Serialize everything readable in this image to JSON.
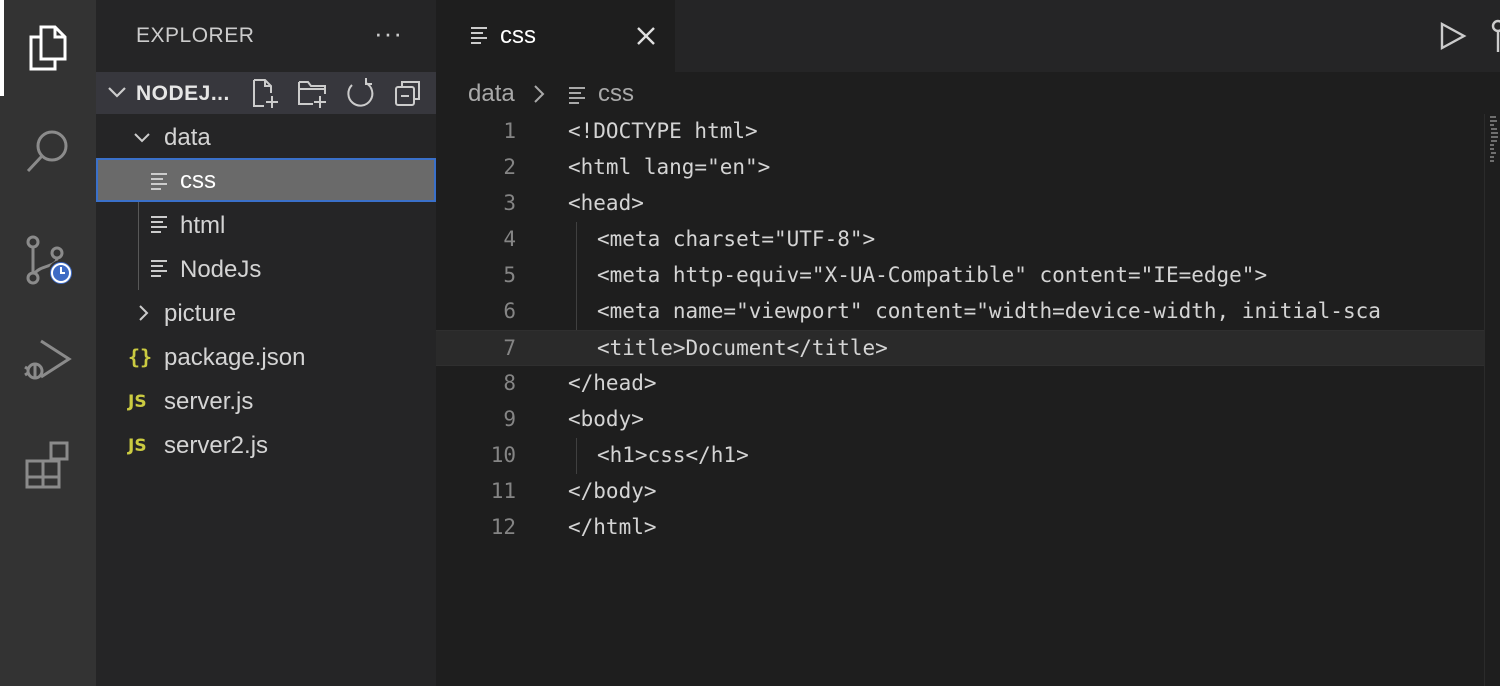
{
  "sidebar": {
    "title": "EXPLORER",
    "more_label": "···",
    "section_label": "NODEJ...",
    "tree": [
      {
        "label": "data",
        "kind": "folder-open"
      },
      {
        "label": "css",
        "kind": "file"
      },
      {
        "label": "html",
        "kind": "file"
      },
      {
        "label": "NodeJs",
        "kind": "file"
      },
      {
        "label": "picture",
        "kind": "folder"
      },
      {
        "label": "package.json",
        "kind": "json",
        "icon_text": "{}"
      },
      {
        "label": "server.js",
        "kind": "js",
        "icon_text": "JS"
      },
      {
        "label": "server2.js",
        "kind": "js",
        "icon_text": "JS"
      }
    ]
  },
  "editor": {
    "tab_label": "css",
    "breadcrumb": {
      "folder": "data",
      "file": "css"
    },
    "lines": [
      {
        "n": "1",
        "text": "<!DOCTYPE html>"
      },
      {
        "n": "2",
        "text": "<html lang=\"en\">"
      },
      {
        "n": "3",
        "text": "<head>"
      },
      {
        "n": "4",
        "text": "<meta charset=\"UTF-8\">"
      },
      {
        "n": "5",
        "text": "<meta http-equiv=\"X-UA-Compatible\" content=\"IE=edge\">"
      },
      {
        "n": "6",
        "text": "<meta name=\"viewport\" content=\"width=device-width, initial-sca"
      },
      {
        "n": "7",
        "text": "<title>Document</title>"
      },
      {
        "n": "8",
        "text": "</head>"
      },
      {
        "n": "9",
        "text": "<body>"
      },
      {
        "n": "10",
        "text": "<h1>css</h1>"
      },
      {
        "n": "11",
        "text": "</body>"
      },
      {
        "n": "12",
        "text": "</html>"
      }
    ]
  },
  "icons": {
    "activity": [
      "files-icon",
      "search-icon",
      "source-control-icon",
      "run-debug-icon",
      "extensions-icon"
    ],
    "tab": [
      "file-lines-icon",
      "close-icon"
    ],
    "toolbar": [
      "run-icon"
    ]
  },
  "colors": {
    "activity_bar": "#333333",
    "sidebar": "#252526",
    "editor": "#1e1e1e",
    "selection": "#6a6a6a",
    "focus_border": "#3a70c9",
    "js_yellow": "#cbcb41",
    "clock_badge": "#3e6bc5"
  }
}
